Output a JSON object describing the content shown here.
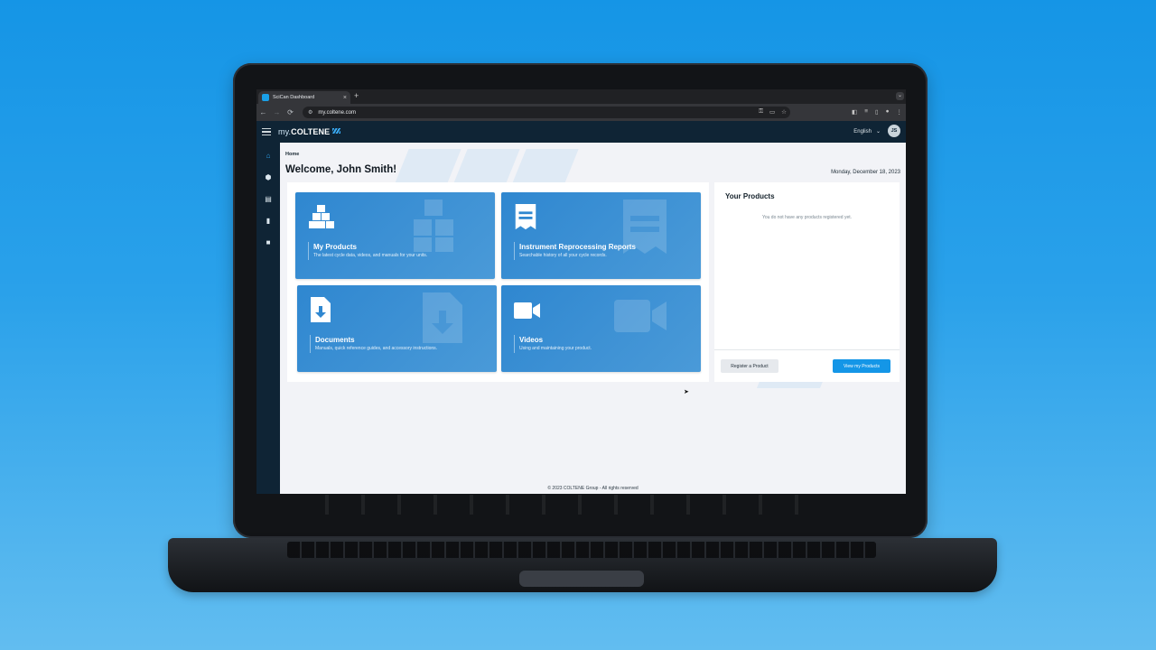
{
  "browser": {
    "tab_title": "SciCan Dashboard",
    "tab_close": "×",
    "new_tab": "+",
    "url": "my.coltene.com",
    "nav": [
      "←",
      "→",
      "⟳"
    ]
  },
  "header": {
    "brand_prefix": "my.",
    "brand_name": "COLTENE",
    "language": "English",
    "avatar_initials": "JS"
  },
  "sidebar": {
    "items": [
      {
        "name": "home-icon",
        "glyph": "⌂",
        "active": true
      },
      {
        "name": "products-icon",
        "glyph": "⬢"
      },
      {
        "name": "reports-icon",
        "glyph": "▤"
      },
      {
        "name": "documents-icon",
        "glyph": "▮"
      },
      {
        "name": "videos-icon",
        "glyph": "■"
      }
    ]
  },
  "main": {
    "breadcrumb": "Home",
    "welcome": "Welcome, John Smith!",
    "date": "Monday, December 18, 2023",
    "tiles": [
      {
        "title": "My Products",
        "desc": "The latest cycle data, videos, and manuals for your units.",
        "icon": "cubes-icon"
      },
      {
        "title": "Instrument Reprocessing Reports",
        "desc": "Searchable history of all your cycle records.",
        "icon": "receipt-icon"
      },
      {
        "title": "Documents",
        "desc": "Manuals, quick reference guides, and accessory instructions.",
        "icon": "document-download-icon"
      },
      {
        "title": "Videos",
        "desc": "Using and maintaining your product.",
        "icon": "video-camera-icon"
      }
    ],
    "products_panel": {
      "title": "Your Products",
      "empty_text": "You do not have any products registered yet.",
      "register_label": "Register a Product",
      "view_label": "View my Products"
    },
    "footer": "© 2023 COLTENE Group - All rights reserved"
  },
  "colors": {
    "background": "#1595e6",
    "app_header": "#0f2435",
    "tile": "#2f87d0",
    "primary_button": "#1496e7"
  }
}
